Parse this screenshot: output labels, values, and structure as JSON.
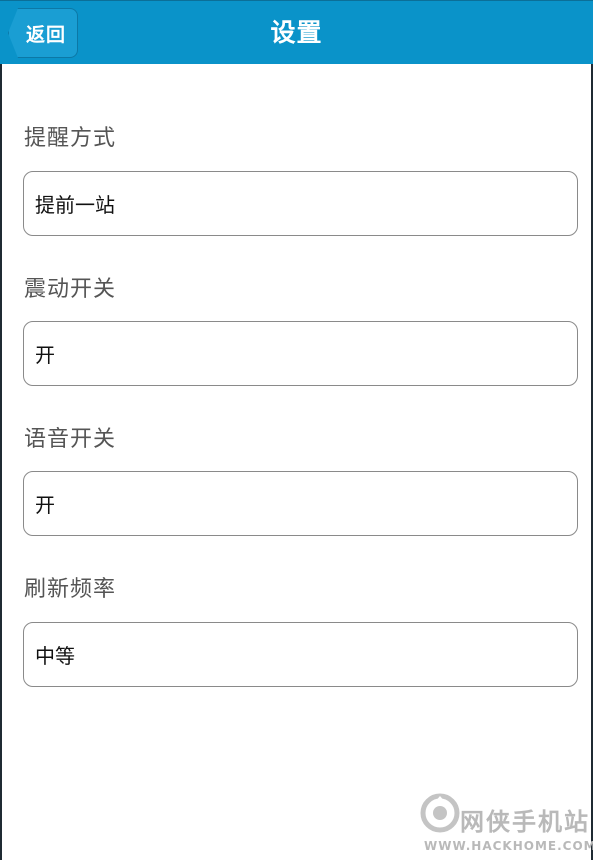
{
  "header": {
    "back_label": "返回",
    "title": "设置"
  },
  "settings": [
    {
      "label": "提醒方式",
      "value": "提前一站"
    },
    {
      "label": "震动开关",
      "value": "开"
    },
    {
      "label": "语音开关",
      "value": "开"
    },
    {
      "label": "刷新频率",
      "value": "中等"
    }
  ],
  "watermark": {
    "text": "网侠手机站",
    "url": "WWW.HACKHOME.COM"
  },
  "colors": {
    "header_bg": "#0a93c9",
    "back_button_bg": "#1a9ed3",
    "label_text": "#555555",
    "field_border": "#8a8a8a"
  }
}
